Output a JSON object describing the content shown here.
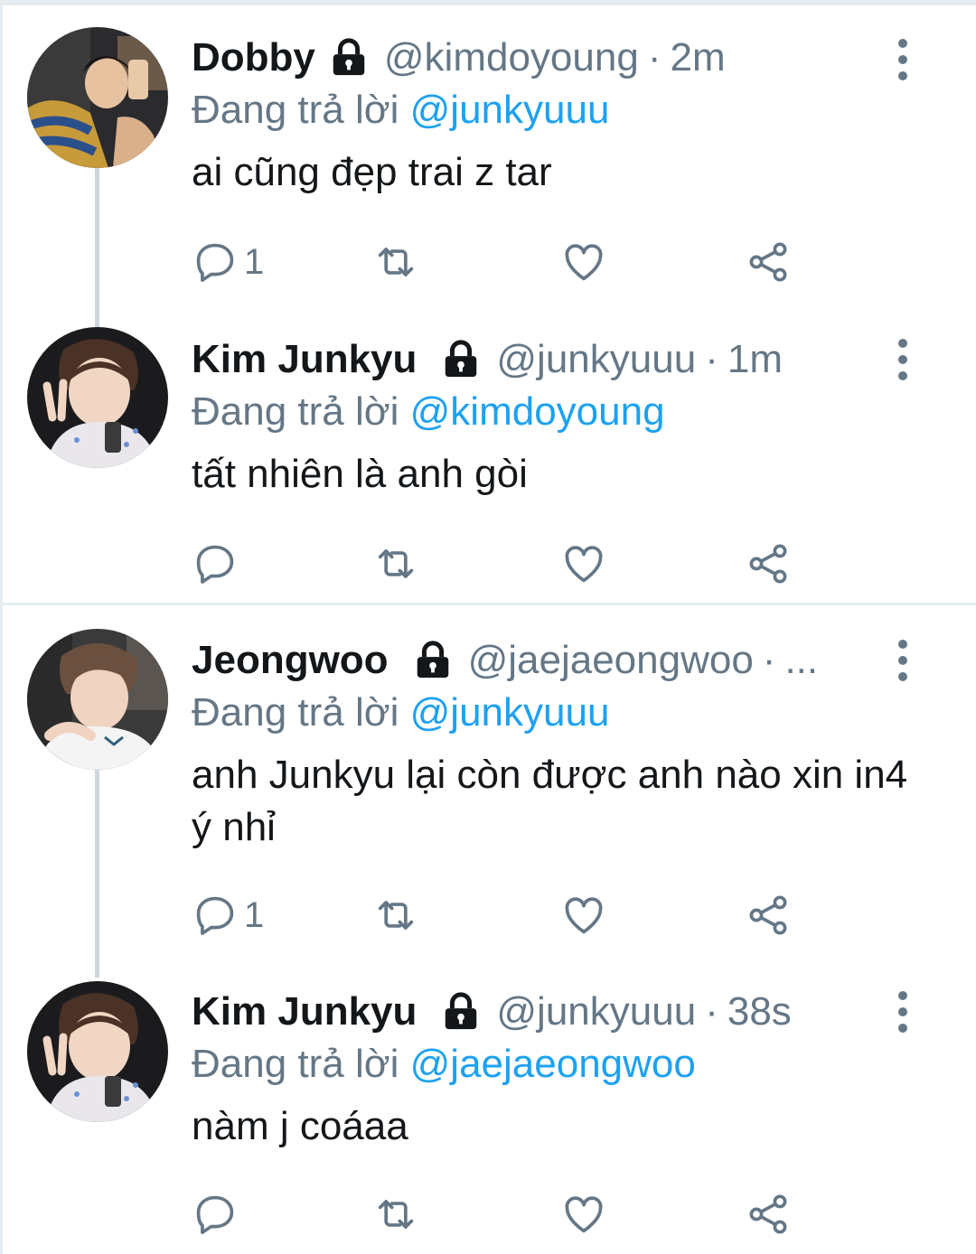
{
  "reply_prefix": "Đang trả lời",
  "separator": "·",
  "colors": {
    "text": "#14171a",
    "muted": "#657786",
    "mention": "#1da1f2",
    "divider": "#e6ecf0"
  },
  "tweets": [
    {
      "name": "Dobby",
      "handle": "@kimdoyoung",
      "time": "2m",
      "reply_to": "@junkyuuu",
      "text": "ai cũng đẹp trai z tar",
      "reply_count": "1"
    },
    {
      "name": "Kim Junkyu",
      "handle": "@junkyuuu",
      "time": "1m",
      "reply_to": "@kimdoyoung",
      "text": "tất nhiên là anh gòi",
      "reply_count": ""
    },
    {
      "name": "Jeongwoo",
      "handle": "@jaejaeongwoo",
      "time": "...",
      "reply_to": "@junkyuuu",
      "text": "anh Junkyu lại còn được anh nào xin in4 ý nhỉ",
      "reply_count": "1"
    },
    {
      "name": "Kim Junkyu",
      "handle": "@junkyuuu",
      "time": "38s",
      "reply_to": "@jaejaeongwoo",
      "text": "nàm j coáaa",
      "reply_count": ""
    }
  ]
}
